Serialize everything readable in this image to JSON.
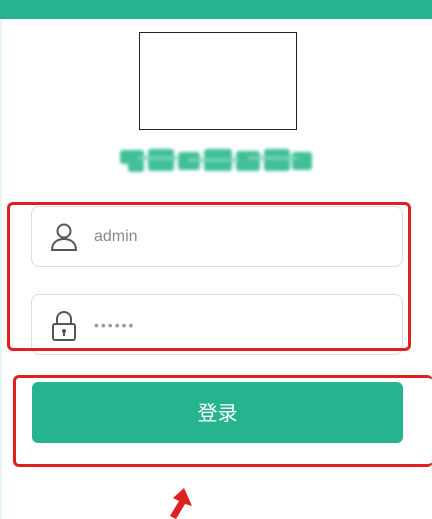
{
  "header": {
    "accent_color": "#26b38f"
  },
  "logo": {
    "description": "logo-placeholder"
  },
  "login_form": {
    "username": {
      "value": "admin",
      "icon": "user-icon"
    },
    "password": {
      "value": "••••••",
      "icon": "lock-icon"
    },
    "submit_label": "登录",
    "button_color": "#26b38f"
  },
  "annotations": {
    "highlight_color": "#e02020",
    "arrow_icon": "arrow-up-icon"
  }
}
